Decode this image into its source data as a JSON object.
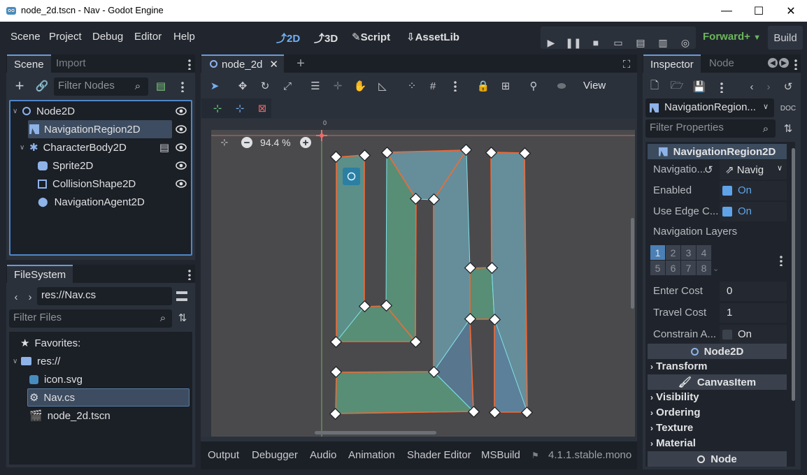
{
  "window": {
    "title": "node_2d.tscn - Nav - Godot Engine",
    "minimize": "—",
    "maximize": "☐",
    "close": "✕"
  },
  "menu": [
    "Scene",
    "Project",
    "Debug",
    "Editor",
    "Help"
  ],
  "workspaces": [
    {
      "label": "2D",
      "icon": "2d-icon",
      "active": true
    },
    {
      "label": "3D",
      "icon": "3d-icon",
      "active": false
    },
    {
      "label": "Script",
      "icon": "script-icon",
      "active": false
    },
    {
      "label": "AssetLib",
      "icon": "assetlib-icon",
      "active": false
    }
  ],
  "renderer": "Forward+",
  "build_label": "Build",
  "scene_dock": {
    "tabs": [
      "Scene",
      "Import"
    ],
    "filter_placeholder": "Filter Nodes",
    "nodes": [
      {
        "label": "Node2D",
        "icon": "node2d-icon",
        "depth": 0,
        "selected": false
      },
      {
        "label": "NavigationRegion2D",
        "icon": "navigation-region-icon",
        "depth": 1,
        "selected": true
      },
      {
        "label": "CharacterBody2D",
        "icon": "character-body-icon",
        "depth": 1,
        "selected": false
      },
      {
        "label": "Sprite2D",
        "icon": "sprite-icon",
        "depth": 2,
        "selected": false
      },
      {
        "label": "CollisionShape2D",
        "icon": "collision-shape-icon",
        "depth": 2,
        "selected": false
      },
      {
        "label": "NavigationAgent2D",
        "icon": "navigation-agent-icon",
        "depth": 2,
        "selected": false
      }
    ]
  },
  "filesystem": {
    "tab": "FileSystem",
    "path": "res://Nav.cs",
    "filter_placeholder": "Filter Files",
    "items": [
      {
        "label": "Favorites:",
        "icon": "star-icon"
      },
      {
        "label": "res://",
        "icon": "folder-icon"
      },
      {
        "label": "icon.svg",
        "icon": "image-icon"
      },
      {
        "label": "Nav.cs",
        "icon": "script-gear-icon"
      },
      {
        "label": "node_2d.tscn",
        "icon": "scene-icon"
      }
    ]
  },
  "viewport": {
    "tab": "node_2d",
    "zoom": "94.4 %",
    "view_menu": "View",
    "ruler_zero": "0"
  },
  "bottom_panel": {
    "tabs": [
      "Output",
      "Debugger",
      "Audio",
      "Animation",
      "Shader Editor",
      "MSBuild"
    ],
    "version": "4.1.1.stable.mono"
  },
  "inspector": {
    "tabs": [
      "Inspector",
      "Node"
    ],
    "object": "NavigationRegion...",
    "filter_placeholder": "Filter Properties",
    "class_header": "NavigationRegion2D",
    "properties": {
      "navigation_label": "Navigatio...",
      "navigation_value": "Navig",
      "enabled_label": "Enabled",
      "enabled_value": "On",
      "edge_label": "Use Edge C...",
      "edge_value": "On",
      "layers_label": "Navigation Layers",
      "layers": [
        "1",
        "2",
        "3",
        "4",
        "5",
        "6",
        "7",
        "8"
      ],
      "enter_cost_label": "Enter Cost",
      "enter_cost": "0",
      "travel_cost_label": "Travel Cost",
      "travel_cost": "1",
      "constrain_label": "Constrain A...",
      "constrain_value": "On"
    },
    "sections": {
      "node2d": "Node2D",
      "transform": "Transform",
      "canvasitem": "CanvasItem",
      "visibility": "Visibility",
      "ordering": "Ordering",
      "texture": "Texture",
      "material": "Material",
      "node": "Node"
    }
  },
  "colors": {
    "accent": "#72b0f4",
    "renderer": "#6cb65c",
    "nav_poly_fill": "#5f9b93",
    "nav_poly_edge": "#ef6a37"
  }
}
